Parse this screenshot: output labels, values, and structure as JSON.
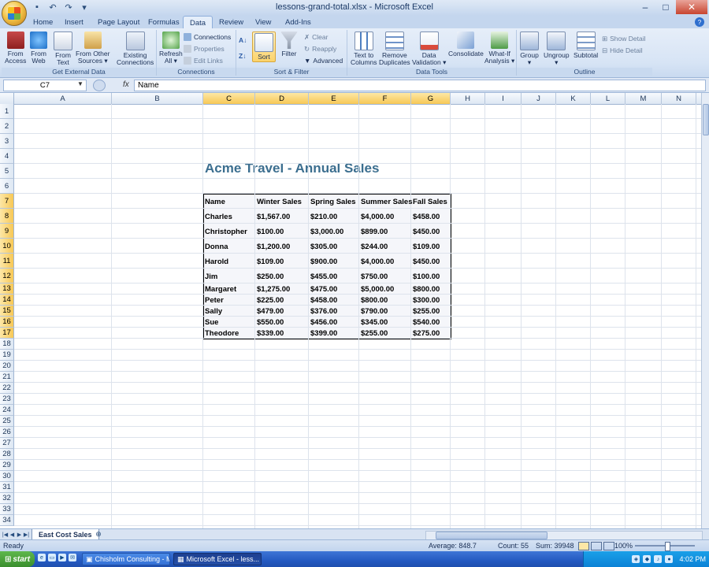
{
  "window": {
    "title": "lessons-grand-total.xlsx - Microsoft Excel",
    "qat_icons": [
      "save-icon",
      "undo-icon",
      "redo-icon",
      "customize-icon"
    ]
  },
  "tabs": [
    {
      "label": "Home"
    },
    {
      "label": "Insert"
    },
    {
      "label": "Page Layout"
    },
    {
      "label": "Formulas"
    },
    {
      "label": "Data",
      "active": true
    },
    {
      "label": "Review"
    },
    {
      "label": "View"
    },
    {
      "label": "Add-Ins"
    }
  ],
  "ribbon": {
    "external": {
      "label": "Get External Data",
      "buttons": [
        {
          "l1": "From",
          "l2": "Access"
        },
        {
          "l1": "From",
          "l2": "Web"
        },
        {
          "l1": "From",
          "l2": "Text"
        },
        {
          "l1": "From Other",
          "l2": "Sources ▾"
        },
        {
          "l1": "Existing",
          "l2": "Connections"
        }
      ]
    },
    "connections": {
      "label": "Connections",
      "refresh": {
        "l1": "Refresh",
        "l2": "All ▾"
      },
      "small": [
        "Connections",
        "Properties",
        "Edit Links"
      ]
    },
    "sortfilter": {
      "label": "Sort & Filter",
      "sort": "Sort",
      "filter": "Filter",
      "small": [
        "Clear",
        "Reapply",
        "Advanced"
      ]
    },
    "datatools": {
      "label": "Data Tools",
      "buttons": [
        {
          "l1": "Text to",
          "l2": "Columns"
        },
        {
          "l1": "Remove",
          "l2": "Duplicates"
        },
        {
          "l1": "Data",
          "l2": "Validation ▾"
        },
        {
          "l1": "Consolidate",
          "l2": ""
        },
        {
          "l1": "What-If",
          "l2": "Analysis ▾"
        }
      ]
    },
    "outline": {
      "label": "Outline",
      "buttons": [
        {
          "l1": "Group",
          "l2": "▾"
        },
        {
          "l1": "Ungroup",
          "l2": "▾"
        },
        {
          "l1": "Subtotal",
          "l2": ""
        }
      ],
      "small": [
        "Show Detail",
        "Hide Detail"
      ]
    }
  },
  "formula_bar": {
    "name_box": "C7",
    "fx": "fx",
    "value": "Name"
  },
  "columns": [
    "A",
    "B",
    "C",
    "D",
    "E",
    "F",
    "G",
    "H",
    "I",
    "J",
    "K",
    "L",
    "M",
    "N"
  ],
  "rows": [
    "1",
    "2",
    "3",
    "4",
    "5",
    "6",
    "7",
    "8",
    "9",
    "10",
    "11",
    "12",
    "13",
    "14",
    "15",
    "16",
    "17",
    "18",
    "19",
    "20",
    "21",
    "22",
    "23",
    "24",
    "25",
    "26",
    "27",
    "28",
    "29",
    "30",
    "31",
    "32",
    "33",
    "34"
  ],
  "sheet": {
    "title": "Acme Travel - Annual Sales",
    "headers": [
      "Name",
      "Winter Sales",
      "Spring Sales",
      "Summer Sales",
      "Fall Sales"
    ],
    "rows": [
      [
        "Charles",
        "$1,567.00",
        "$210.00",
        "$4,000.00",
        "$458.00"
      ],
      [
        "Christopher",
        "$100.00",
        "$3,000.00",
        "$899.00",
        "$450.00"
      ],
      [
        "Donna",
        "$1,200.00",
        "$305.00",
        "$244.00",
        "$109.00"
      ],
      [
        "Harold",
        "$109.00",
        "$900.00",
        "$4,000.00",
        "$450.00"
      ],
      [
        "Jim",
        "$250.00",
        "$455.00",
        "$750.00",
        "$100.00"
      ],
      [
        "Margaret",
        "$1,275.00",
        "$475.00",
        "$5,000.00",
        "$800.00"
      ],
      [
        "Peter",
        "$225.00",
        "$458.00",
        "$800.00",
        "$300.00"
      ],
      [
        "Sally",
        "$479.00",
        "$376.00",
        "$790.00",
        "$255.00"
      ],
      [
        "Sue",
        "$550.00",
        "$456.00",
        "$345.00",
        "$540.00"
      ],
      [
        "Theodore",
        "$339.00",
        "$399.00",
        "$255.00",
        "$275.00"
      ]
    ]
  },
  "sheet_tab": "East Cost Sales",
  "status": {
    "mode": "Ready",
    "average": "Average: 848.7",
    "count": "Count: 55",
    "sum": "Sum: 39948",
    "zoom": "100%"
  },
  "taskbar": {
    "start": "start",
    "tasks": [
      "Chisholm Consulting - Mo...",
      "Microsoft Excel - less..."
    ],
    "clock": "4:02 PM"
  }
}
